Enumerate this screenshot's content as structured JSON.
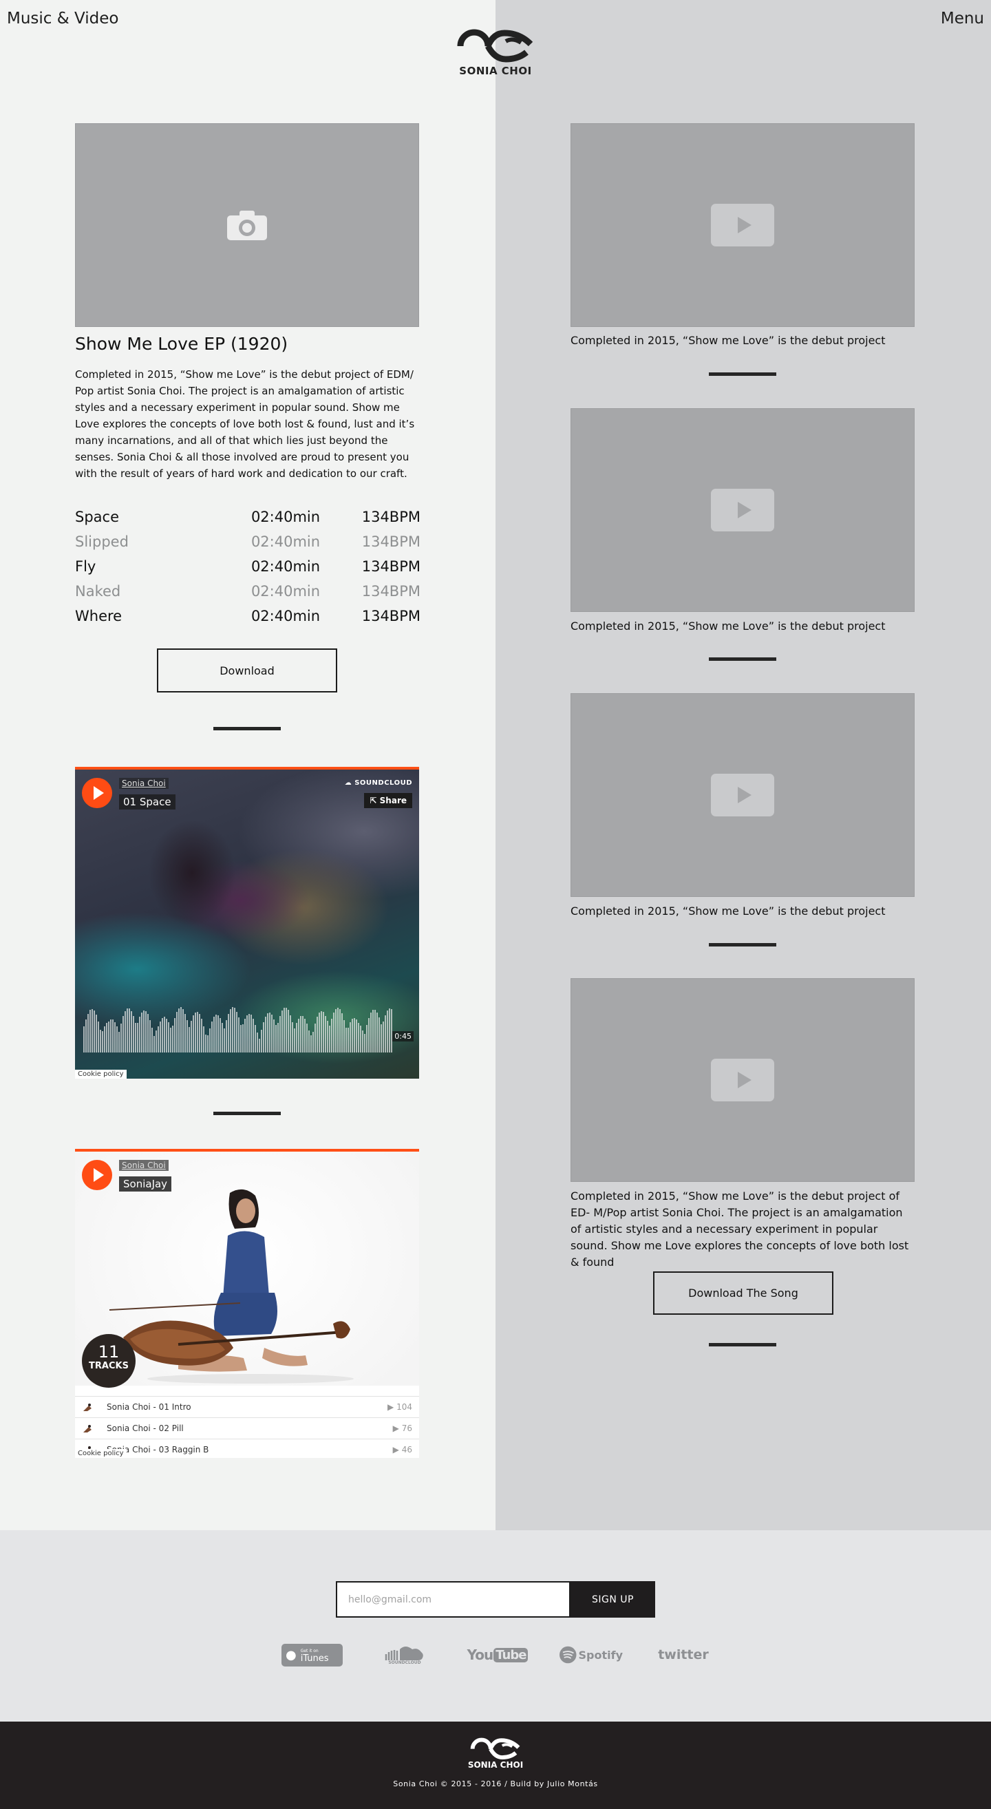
{
  "nav": {
    "left": "Music & Video",
    "right": "Menu",
    "logo_text": "SONIA CHOI"
  },
  "album": {
    "title": "Show Me Love EP (1920)",
    "description": "Completed in 2015, “Show me Love” is the debut project of EDM/ Pop artist Sonia Choi. The project is an amalgamation of artistic styles and a necessary experiment in popular sound. Show me Love explores the concepts of love both lost & found, lust and it’s many incarnations, and all of that which lies just beyond the senses. Sonia Choi & all those involved are proud to present you with the result of years of hard work and dedication to our craft.",
    "tracks": [
      {
        "name": "Space",
        "duration": "02:40min",
        "bpm": "134BPM",
        "highlight": true
      },
      {
        "name": "Slipped",
        "duration": "02:40min",
        "bpm": "134BPM",
        "highlight": false
      },
      {
        "name": "Fly",
        "duration": "02:40min",
        "bpm": "134BPM",
        "highlight": true
      },
      {
        "name": "Naked",
        "duration": "02:40min",
        "bpm": "134BPM",
        "highlight": false
      },
      {
        "name": "Where",
        "duration": "02:40min",
        "bpm": "134BPM",
        "highlight": true
      }
    ],
    "download_label": "Download"
  },
  "soundcloud_1": {
    "user": "Sonia Choi",
    "track": "01 Space",
    "brand": "SOUNDCLOUD",
    "share": "Share",
    "time": "0:45",
    "cookie": "Cookie policy"
  },
  "soundcloud_2": {
    "user": "Sonia Choi",
    "track": "SoniaJay",
    "count": "11",
    "count_label": "TRACKS",
    "list": [
      {
        "name": "Sonia Choi - 01 Intro",
        "plays": "104"
      },
      {
        "name": "Sonia Choi - 02 Pill",
        "plays": "76"
      },
      {
        "name": "Sonia Choi - 03 Raggin B",
        "plays": "46"
      }
    ],
    "cookie": "Cookie policy"
  },
  "videos": {
    "caption_short": "Completed in 2015, “Show me Love” is the debut project",
    "caption_long": "Completed in 2015, “Show me Love” is the debut project of ED- M/Pop artist Sonia Choi. The project is an amalgamation of artistic styles and a necessary experiment in popular sound. Show me Love explores the concepts of love both lost & found",
    "download_song_label": "Download The Song"
  },
  "newsletter": {
    "placeholder": "hello@gmail.com",
    "signup_label": "SIGN UP"
  },
  "social": {
    "itunes_small": "Get it on",
    "itunes": "iTunes",
    "soundcloud": "SOUNDCLOUD",
    "youtube_you": "You",
    "youtube_tube": "Tube",
    "spotify": "Spotify",
    "twitter": "twitter"
  },
  "footer": {
    "logo_text": "SONIA CHOI",
    "copyright": "Sonia Choi © 2015 - 2016 / Build by Julio Montás"
  },
  "colors": {
    "accent": "#ff4f16",
    "dark": "#1f1d1e",
    "left_bg": "#f2f3f2",
    "right_bg": "#d3d4d6"
  }
}
